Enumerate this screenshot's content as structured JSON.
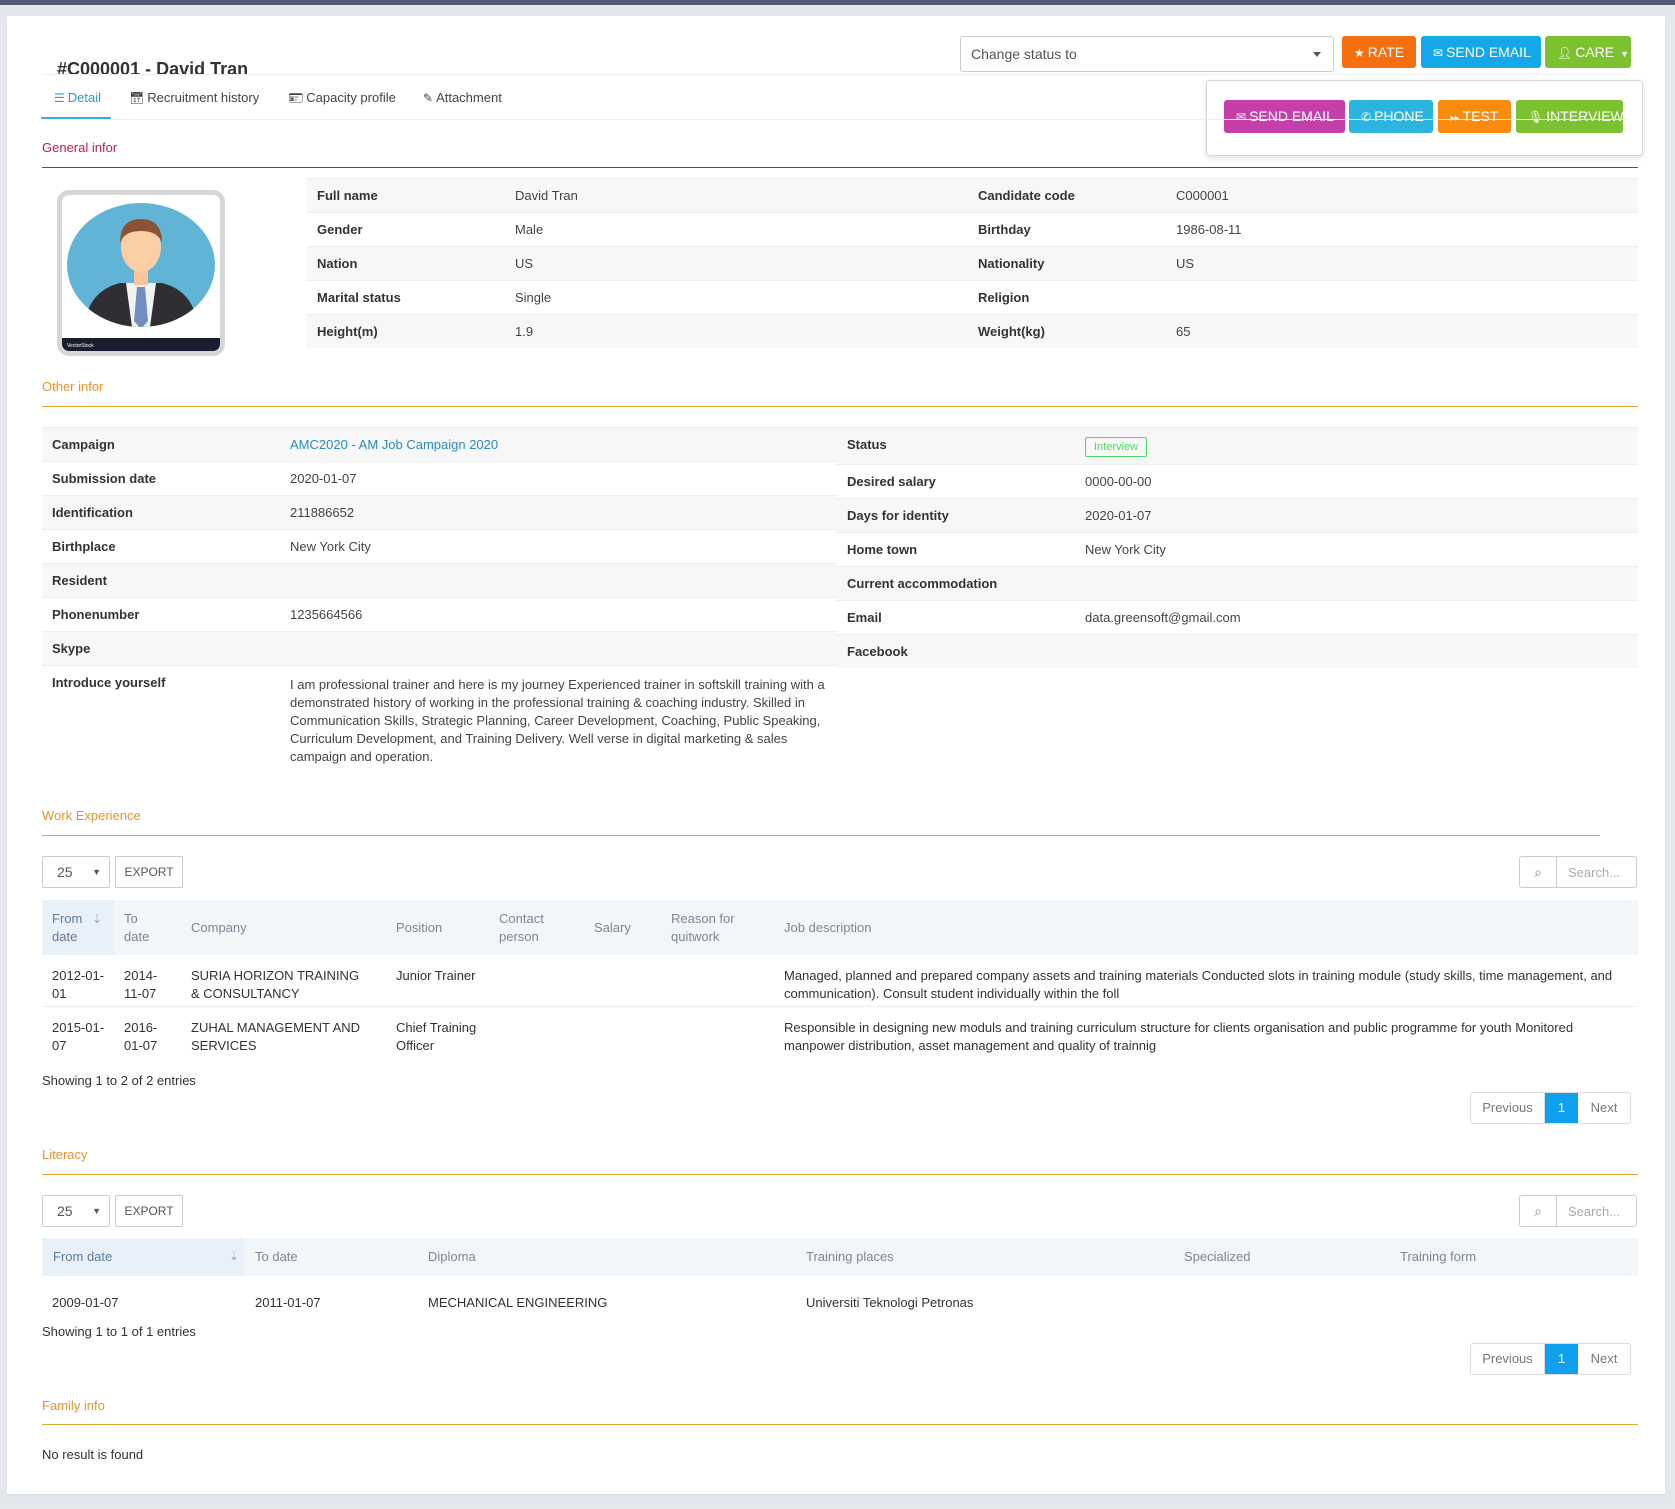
{
  "header": {
    "title": "#C000001 - David Tran",
    "status_select": {
      "value": "Change status to"
    },
    "buttons": {
      "rate": "RATE",
      "send_email": "SEND EMAIL",
      "care": "CARE"
    },
    "care_menu": {
      "send_email": "SEND EMAIL",
      "phone": "PHONE",
      "test": "TEST",
      "interview": "INTERVIEW"
    },
    "colors": {
      "rate": "#f66f0f",
      "send_email": "#12a8ea",
      "care": "#7cc12f",
      "menu_send_email": "#c53eaa",
      "menu_phone": "#2ab4df",
      "menu_test": "#fb8b0f",
      "menu_interview": "#7cc12f"
    }
  },
  "tabs": [
    {
      "label": "Detail",
      "icon": "list-icon",
      "active": true
    },
    {
      "label": "Recruitment history",
      "icon": "calendar-icon",
      "active": false
    },
    {
      "label": "Capacity profile",
      "icon": "id-card-icon",
      "active": false
    },
    {
      "label": "Attachment",
      "icon": "paperclip-icon",
      "active": false
    }
  ],
  "general": {
    "label": "General infor",
    "left": [
      {
        "label": "Full name",
        "value": "David Tran"
      },
      {
        "label": "Gender",
        "value": "Male"
      },
      {
        "label": "Nation",
        "value": "US"
      },
      {
        "label": "Marital status",
        "value": "Single"
      },
      {
        "label": "Height(m)",
        "value": "1.9"
      }
    ],
    "right": [
      {
        "label": "Candidate code",
        "value": "C000001"
      },
      {
        "label": "Birthday",
        "value": "1986-08-11"
      },
      {
        "label": "Nationality",
        "value": "US"
      },
      {
        "label": "Religion",
        "value": ""
      },
      {
        "label": "Weight(kg)",
        "value": "65"
      }
    ]
  },
  "other": {
    "label": "Other infor",
    "left": [
      {
        "label": "Campaign",
        "value": "AMC2020 - AM Job Campaign 2020"
      },
      {
        "label": "Submission date",
        "value": "2020-01-07"
      },
      {
        "label": "Identification",
        "value": "211886652"
      },
      {
        "label": "Birthplace",
        "value": "New York City"
      },
      {
        "label": "Resident",
        "value": ""
      },
      {
        "label": "Phonenumber",
        "value": "1235664566"
      },
      {
        "label": "Skype",
        "value": ""
      },
      {
        "label": "Introduce yourself",
        "value": "I am professional trainer and here is my journey Experienced trainer in softskill training with a demonstrated history of working in the professional training & coaching industry. Skilled in Communication Skills, Strategic Planning, Career Development, Coaching, Public Speaking, Curriculum Development, and Training Delivery. Well verse in digital marketing & sales campaign and operation."
      }
    ],
    "right": [
      {
        "label": "Status",
        "value": "Interview"
      },
      {
        "label": "Desired salary",
        "value": "0000-00-00"
      },
      {
        "label": "Days for identity",
        "value": "2020-01-07"
      },
      {
        "label": "Home town",
        "value": "New York City"
      },
      {
        "label": "Current accommodation",
        "value": ""
      },
      {
        "label": "Email",
        "value": "data.greensoft@gmail.com"
      },
      {
        "label": "Facebook",
        "value": ""
      }
    ]
  },
  "work": {
    "label": "Work Experience",
    "page_length": "25",
    "export_label": "EXPORT",
    "search_placeholder": "Search...",
    "columns": [
      "From date",
      "To date",
      "Company",
      "Position",
      "Contact person",
      "Salary",
      "Reason for quitwork",
      "Job description"
    ],
    "rows": [
      {
        "from": "2012-01-01",
        "to": "2014-11-07",
        "company": "SURIA HORIZON TRAINING & CONSULTANCY",
        "position": "Junior Trainer",
        "contact": "",
        "salary": "",
        "reason": "",
        "description": "Managed, planned and prepared company assets and training materials Conducted slots in training module (study skills, time management, and communication). Consult student individually within the foll"
      },
      {
        "from": "2015-01-07",
        "to": "2016-01-07",
        "company": "ZUHAL MANAGEMENT AND SERVICES",
        "position": "Chief Training Officer",
        "contact": "",
        "salary": "",
        "reason": "",
        "description": "Responsible in designing new moduls and training curriculum structure for clients organisation and public programme for youth Monitored manpower distribution, asset management and quality of trainnig"
      }
    ],
    "showing": "Showing 1 to 2 of 2 entries",
    "pager": {
      "previous": "Previous",
      "current": "1",
      "next": "Next"
    }
  },
  "literacy": {
    "label": "Literacy",
    "page_length": "25",
    "export_label": "EXPORT",
    "search_placeholder": "Search...",
    "columns": [
      "From date",
      "To date",
      "Diploma",
      "Training places",
      "Specialized",
      "Training form"
    ],
    "rows": [
      {
        "from": "2009-01-07",
        "to": "2011-01-07",
        "diploma": "MECHANICAL ENGINEERING",
        "place": "Universiti Teknologi Petronas",
        "specialized": "",
        "form": ""
      }
    ],
    "showing": "Showing 1 to 1 of 1 entries",
    "pager": {
      "previous": "Previous",
      "current": "1",
      "next": "Next"
    }
  },
  "family": {
    "label": "Family info",
    "empty_text": "No result is found"
  }
}
